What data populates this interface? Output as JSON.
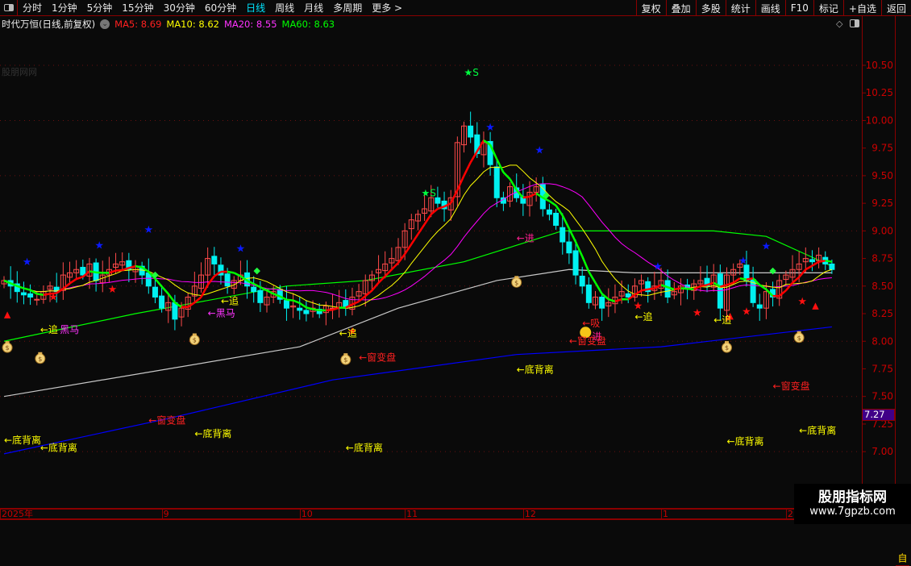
{
  "topbar": {
    "periods": [
      "分时",
      "1分钟",
      "5分钟",
      "15分钟",
      "30分钟",
      "60分钟",
      "日线",
      "周线",
      "月线",
      "多周期",
      "更多 >"
    ],
    "active": "日线",
    "buttons": [
      "复权",
      "叠加",
      "多股",
      "统计",
      "画线",
      "F10",
      "标记",
      "+自选",
      "返回"
    ]
  },
  "title": {
    "name": "时代万恒(日线,前复权)",
    "ma5": "MA5: 8.69",
    "ma10": "MA10: 8.62",
    "ma20": "MA20: 8.55",
    "ma60": "MA60: 8.63"
  },
  "colors": {
    "up": "#ff4a4a",
    "down": "#00f0f0",
    "ma5": "#ff0000",
    "ma5_fall": "#00ff00",
    "ma10": "#ffff00",
    "ma20": "#ff00ff",
    "ma60": "#00ff00",
    "grey": "#c8c8c8",
    "blue": "#0000ff",
    "axis": "#cc0000"
  },
  "ghost_watermark": "股朋网网",
  "price_tag": "7.27",
  "sidebar_tabs": [
    "",
    "",
    "",
    "",
    "",
    "",
    "",
    "",
    "自",
    ""
  ],
  "watermark": {
    "name": "股朋指标网",
    "url": "www.7gpzb.com"
  },
  "chart_data": {
    "type": "candlestick",
    "ylim": [
      6.9,
      10.6
    ],
    "yticks": [
      "10.50",
      "10.25",
      "10.00",
      "9.75",
      "9.50",
      "9.25",
      "9.00",
      "8.75",
      "8.50",
      "8.25",
      "8.00",
      "7.75",
      "7.50",
      "7.25",
      "7.00"
    ],
    "date_labels": [
      {
        "text": "2025年",
        "i": 0
      },
      {
        "text": "9",
        "i": 24
      },
      {
        "text": "10",
        "i": 45
      },
      {
        "text": "11",
        "i": 61
      },
      {
        "text": "12",
        "i": 79
      },
      {
        "text": "1",
        "i": 100
      },
      {
        "text": "2",
        "i": 119
      }
    ],
    "closes": [
      8.55,
      8.5,
      8.45,
      8.42,
      8.4,
      8.38,
      8.45,
      8.5,
      8.45,
      8.6,
      8.62,
      8.65,
      8.6,
      8.7,
      8.55,
      8.6,
      8.65,
      8.7,
      8.72,
      8.65,
      8.68,
      8.6,
      8.5,
      8.4,
      8.3,
      8.35,
      8.2,
      8.3,
      8.4,
      8.5,
      8.6,
      8.75,
      8.7,
      8.6,
      8.5,
      8.55,
      8.6,
      8.5,
      8.45,
      8.35,
      8.4,
      8.45,
      8.38,
      8.3,
      8.32,
      8.28,
      8.25,
      8.3,
      8.25,
      8.32,
      8.3,
      8.35,
      8.3,
      8.4,
      8.45,
      8.55,
      8.6,
      8.65,
      8.7,
      8.75,
      8.85,
      9.0,
      9.1,
      9.15,
      9.2,
      9.3,
      9.25,
      9.2,
      9.3,
      9.8,
      9.95,
      9.85,
      9.7,
      9.8,
      9.6,
      9.3,
      9.25,
      9.4,
      9.3,
      9.25,
      9.35,
      9.4,
      9.2,
      9.15,
      9.05,
      8.9,
      8.8,
      8.6,
      8.5,
      8.35,
      8.4,
      8.3,
      8.35,
      8.4,
      8.45,
      8.4,
      8.5,
      8.55,
      8.45,
      8.5,
      8.55,
      8.4,
      8.45,
      8.5,
      8.48,
      8.52,
      8.55,
      8.5,
      8.6,
      8.3,
      8.6,
      8.65,
      8.7,
      8.55,
      8.35,
      8.3,
      8.45,
      8.4,
      8.55,
      8.6,
      8.65,
      8.7,
      8.75,
      8.72,
      8.78,
      8.7,
      8.65
    ],
    "ma60_line": [
      [
        0,
        8.0
      ],
      [
        20,
        8.25
      ],
      [
        43,
        8.5
      ],
      [
        55,
        8.55
      ],
      [
        70,
        8.72
      ],
      [
        85,
        9.0
      ],
      [
        108,
        9.0
      ],
      [
        116,
        8.95
      ],
      [
        126,
        8.68
      ]
    ],
    "grey_line": [
      [
        0,
        7.5
      ],
      [
        25,
        7.75
      ],
      [
        45,
        7.95
      ],
      [
        60,
        8.3
      ],
      [
        75,
        8.55
      ],
      [
        86,
        8.65
      ],
      [
        96,
        8.62
      ],
      [
        126,
        8.62
      ]
    ],
    "blue_line": [
      [
        0,
        6.98
      ],
      [
        25,
        7.3
      ],
      [
        50,
        7.65
      ],
      [
        78,
        7.88
      ],
      [
        100,
        7.95
      ],
      [
        126,
        8.13
      ]
    ],
    "annotations": [
      {
        "text": "←底背离",
        "i": 0,
        "p": 7.11,
        "color": "#ffff00"
      },
      {
        "text": "←底背离",
        "i": 5.5,
        "p": 7.04,
        "color": "#ffff00"
      },
      {
        "text": "←底背离",
        "i": 29,
        "p": 7.17,
        "color": "#ffff00"
      },
      {
        "text": "←底背离",
        "i": 52,
        "p": 7.04,
        "color": "#ffff00"
      },
      {
        "text": "←底背离",
        "i": 78,
        "p": 7.75,
        "color": "#ffff00"
      },
      {
        "text": "←底背离",
        "i": 110,
        "p": 7.1,
        "color": "#ffff00"
      },
      {
        "text": "←底背离",
        "i": 121,
        "p": 7.2,
        "color": "#ffff00"
      },
      {
        "text": "←窗变盘",
        "i": 22,
        "p": 7.29,
        "color": "#ff2020"
      },
      {
        "text": "←窗变盘",
        "i": 54,
        "p": 7.86,
        "color": "#ff2020"
      },
      {
        "text": "←窗变盘",
        "i": 86,
        "p": 8.01,
        "color": "#ff2020"
      },
      {
        "text": "←窗变盘",
        "i": 117,
        "p": 7.6,
        "color": "#ff2020"
      },
      {
        "text": "←追",
        "i": 5.5,
        "p": 8.11,
        "color": "#ffff00"
      },
      {
        "text": "黑马",
        "i": 8.5,
        "p": 8.11,
        "color": "#ff33ff"
      },
      {
        "text": "←追",
        "i": 33,
        "p": 8.37,
        "color": "#ffff00"
      },
      {
        "text": "←黑马",
        "i": 31,
        "p": 8.26,
        "color": "#ff33ff"
      },
      {
        "text": "←追",
        "i": 51,
        "p": 8.08,
        "color": "#ffff00"
      },
      {
        "text": "←追",
        "i": 96,
        "p": 8.23,
        "color": "#ffff00"
      },
      {
        "text": "←追",
        "i": 108,
        "p": 8.2,
        "color": "#ffff00"
      },
      {
        "text": "←进",
        "i": 78,
        "p": 8.94,
        "color": "#ff2090"
      },
      {
        "text": "←吸",
        "i": 88,
        "p": 8.17,
        "color": "#ff2020"
      },
      {
        "text": "进",
        "i": 89.5,
        "p": 8.05,
        "color": "#ff2090"
      },
      {
        "text": "★S",
        "i": 70,
        "p": 10.44,
        "color": "#00ff40"
      },
      {
        "text": "★S",
        "i": 63.5,
        "p": 9.35,
        "color": "#00ff40"
      }
    ],
    "markers": {
      "moneybag": [
        [
          0.5,
          7.95
        ],
        [
          5.5,
          7.85
        ],
        [
          29,
          8.02
        ],
        [
          52,
          7.84
        ],
        [
          78,
          8.54
        ],
        [
          110,
          7.95
        ],
        [
          121,
          8.04
        ]
      ],
      "smiley": [
        [
          88.5,
          8.08
        ]
      ],
      "blue_star": [
        [
          3.5,
          8.73
        ],
        [
          14.5,
          8.88
        ],
        [
          22,
          9.02
        ],
        [
          36,
          8.85
        ],
        [
          74,
          9.95
        ],
        [
          81.5,
          9.74
        ],
        [
          99.5,
          8.69
        ],
        [
          112.5,
          8.74
        ],
        [
          116,
          8.87
        ]
      ],
      "red_star": [
        [
          7.5,
          8.41
        ],
        [
          16.5,
          8.48
        ],
        [
          53,
          8.1
        ],
        [
          96.5,
          8.33
        ],
        [
          105.5,
          8.27
        ],
        [
          113,
          8.28
        ],
        [
          121.5,
          8.37
        ]
      ],
      "red_triangle": [
        [
          0.5,
          8.25
        ],
        [
          123.5,
          8.33
        ],
        [
          110.5,
          8.24
        ]
      ],
      "green_diamond": [
        [
          23,
          8.61
        ],
        [
          38.5,
          8.65
        ],
        [
          82.5,
          9.33
        ],
        [
          117,
          8.65
        ]
      ]
    }
  }
}
